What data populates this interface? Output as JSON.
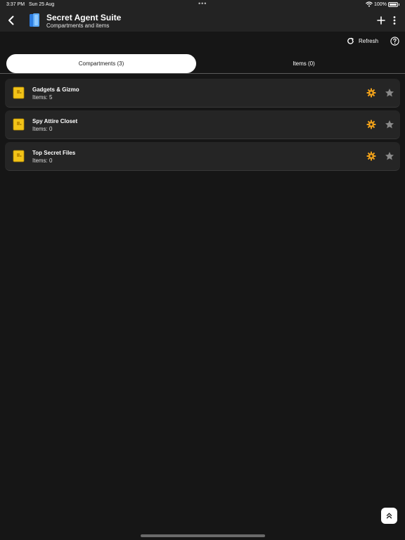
{
  "status_bar": {
    "time": "3:37 PM",
    "date": "Sun 25 Aug",
    "battery": "100%"
  },
  "header": {
    "title": "Secret Agent Suite",
    "subtitle": "Compartments and items"
  },
  "toolbar": {
    "refresh_label": "Refresh"
  },
  "tabs": [
    {
      "label": "Compartments (3)",
      "active": true
    },
    {
      "label": "Items (0)",
      "active": false
    }
  ],
  "compartments": [
    {
      "name": "Gadgets & Gizmo",
      "count": "Items: 5"
    },
    {
      "name": "Spy Attire Closet",
      "count": "Items: 0"
    },
    {
      "name": "Top Secret Files",
      "count": "Items: 0"
    }
  ],
  "colors": {
    "background": "#161616",
    "header": "#232323",
    "row": "#252525",
    "accent_gear": "#f0a11a",
    "folder": "#f2c318",
    "star": "#8a8a8a"
  },
  "icons": {
    "back": "chevron-left-icon",
    "app": "app-logo-icon",
    "add": "plus-icon",
    "more": "more-vertical-icon",
    "refresh": "refresh-icon",
    "help": "help-circle-icon",
    "folder": "folder-icon",
    "gear": "gear-icon",
    "star": "star-icon",
    "scroll_top": "chevrons-up-icon"
  }
}
